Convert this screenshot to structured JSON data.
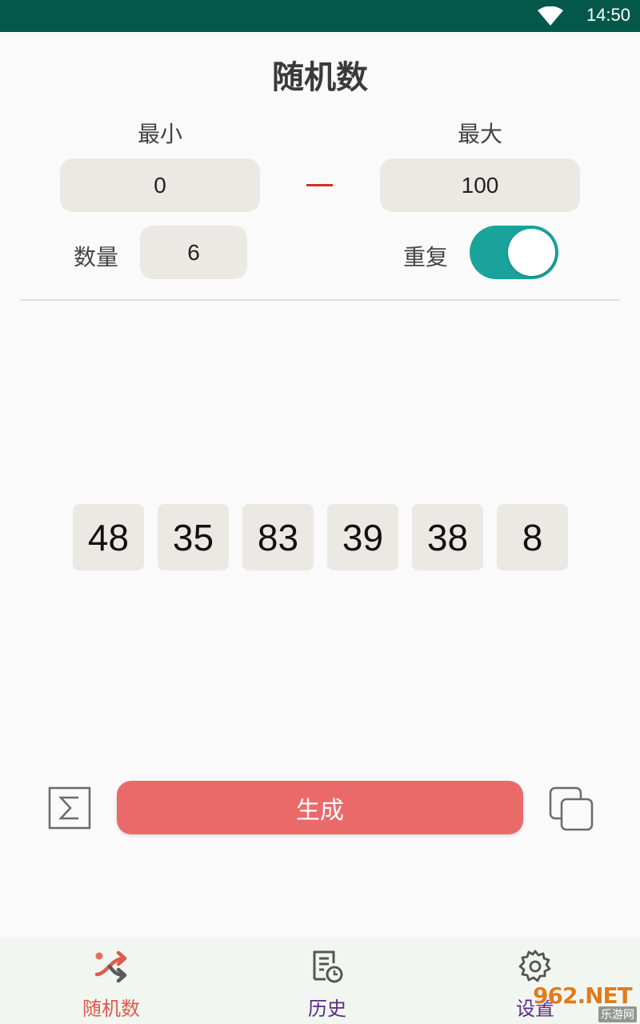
{
  "status_bar": {
    "time": "14:50",
    "wifi_icon": "wifi-icon"
  },
  "title": "随机数",
  "range": {
    "min_label": "最小",
    "min_value": "0",
    "max_label": "最大",
    "max_value": "100"
  },
  "count": {
    "label": "数量",
    "value": "6"
  },
  "repeat": {
    "label": "重复",
    "enabled": true
  },
  "results": [
    "48",
    "35",
    "83",
    "39",
    "38",
    "8"
  ],
  "actions": {
    "sum_icon": "sigma-icon",
    "generate_label": "生成",
    "copy_icon": "copy-icon"
  },
  "bottom_nav": {
    "items": [
      {
        "label": "随机数",
        "icon": "shuffle-icon",
        "active": true
      },
      {
        "label": "历史",
        "icon": "history-icon",
        "active": false
      },
      {
        "label": "设置",
        "icon": "gear-icon",
        "active": false
      }
    ]
  },
  "watermark": {
    "text": "962.NET",
    "subtext": "乐游网"
  },
  "colors": {
    "status_bar": "#03584a",
    "accent": "#ea6a6a",
    "switch_on": "#1aa39b",
    "pill_bg": "#ece9e4",
    "nav_active": "#e05a4a",
    "nav_inactive": "#5b2a86"
  }
}
